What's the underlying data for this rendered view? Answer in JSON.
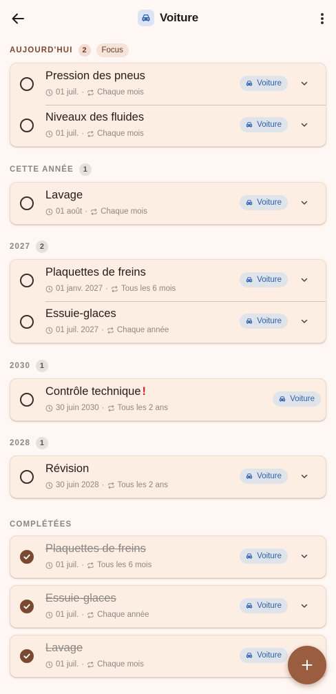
{
  "header": {
    "title": "Voiture",
    "back_icon": "arrow-left-icon",
    "title_icon": "car-icon",
    "more_icon": "more-vert-icon"
  },
  "sections": [
    {
      "label": "AUJOURD'HUI",
      "count": "2",
      "focus_label": "Focus",
      "tasks": [
        {
          "title": "Pression des pneus",
          "date": "01 juil.",
          "recurrence": "Chaque mois",
          "tag": "Voiture",
          "done": false
        },
        {
          "title": "Niveaux des fluides",
          "date": "01 juil.",
          "recurrence": "Chaque mois",
          "tag": "Voiture",
          "done": false
        }
      ]
    },
    {
      "label": "CETTE ANNÉE",
      "count": "1",
      "tasks": [
        {
          "title": "Lavage",
          "date": "01 août",
          "recurrence": "Chaque mois",
          "tag": "Voiture",
          "done": false
        }
      ]
    },
    {
      "label": "2027",
      "count": "2",
      "tasks": [
        {
          "title": "Plaquettes de freins",
          "date": "01 janv. 2027",
          "recurrence": "Tous les 6 mois",
          "tag": "Voiture",
          "done": false
        },
        {
          "title": "Essuie-glaces",
          "date": "01 juil. 2027",
          "recurrence": "Chaque année",
          "tag": "Voiture",
          "done": false
        }
      ]
    },
    {
      "label": "2030",
      "count": "1",
      "tasks": [
        {
          "title": "Contrôle technique",
          "urgent": "!",
          "date": "30 juin 2030",
          "recurrence": "Tous les 2 ans",
          "tag": "Voiture",
          "done": false
        }
      ]
    },
    {
      "label": "2028",
      "count": "1",
      "tasks": [
        {
          "title": "Révision",
          "date": "30 juin 2028",
          "recurrence": "Tous les 2 ans",
          "tag": "Voiture",
          "done": false
        }
      ]
    },
    {
      "label": "COMPLÉTÉES",
      "completed": [
        {
          "title": "Plaquettes de freins",
          "date": "01 juil.",
          "recurrence": "Tous les 6 mois",
          "tag": "Voiture",
          "done": true
        },
        {
          "title": "Essuie-glaces",
          "date": "01 juil.",
          "recurrence": "Chaque année",
          "tag": "Voiture",
          "done": true
        },
        {
          "title": "Lavage",
          "date": "01 juil.",
          "recurrence": "Chaque mois",
          "tag": "Voiture",
          "done": true
        }
      ]
    }
  ],
  "fab_icon": "plus-icon",
  "colors": {
    "background": "#fff7f3",
    "card": "#fdeee3",
    "accent": "#9a5d40",
    "chip_bg": "#dfe3ea",
    "chip_text": "#2f5fa8",
    "urgent": "#d21d1d"
  }
}
